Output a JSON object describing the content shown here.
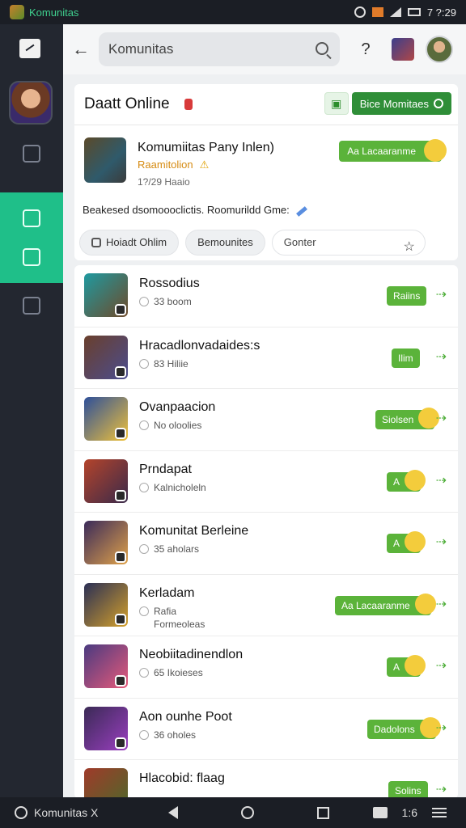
{
  "status_bar": {
    "app_name": "Komunitas",
    "time": "7 ?:29",
    "icons": [
      "alert-icon",
      "notification-icon",
      "signal-icon",
      "wifi-icon",
      "battery-icon"
    ]
  },
  "rail": {
    "items": [
      {
        "name": "compose",
        "icon": "compose-icon"
      },
      {
        "name": "home",
        "icon": "home-icon"
      },
      {
        "name": "book",
        "icon": "book-icon"
      },
      {
        "name": "discover",
        "icon": "compass-icon",
        "active": true
      },
      {
        "name": "groups",
        "icon": "group-icon"
      }
    ]
  },
  "topbar": {
    "back_icon": "back-arrow-icon",
    "search_value": "Komunitas",
    "help_icon": "help-icon"
  },
  "header": {
    "title": "Daatt Online",
    "action_label": "Bice Momitaes",
    "feature": {
      "title": "Komumiitas Pany Inlen)",
      "subtitle": "Raamitolion",
      "meta": "1?/29 Haaio",
      "follow_label": "Aa Lacaaranme"
    },
    "description": "Beakesed dsomoooclictis. Roomurildd Gme:",
    "chips": [
      "Hoiadt Ohlim",
      "Bemounites"
    ],
    "input_placeholder": "Gonter"
  },
  "list": [
    {
      "title": "Rossodius",
      "sub": "33 boom",
      "action": "Raiins",
      "has_smile": false,
      "colors": [
        "#1f9aa0",
        "#6e4a2a"
      ]
    },
    {
      "title": "Hracadlonvadaides:s",
      "sub": "83 Hiliie",
      "action": "Ilim",
      "has_smile": false,
      "colors": [
        "#6a3f2c",
        "#4b4d8e"
      ]
    },
    {
      "title": "Ovanpaacion",
      "sub": "No oloolies",
      "action": "Siolsen",
      "has_smile": true,
      "colors": [
        "#2d4f9a",
        "#f0c23a"
      ]
    },
    {
      "title": "Prndapat",
      "sub": "Kalnicholeln",
      "action": "A",
      "has_smile": true,
      "colors": [
        "#b4442b",
        "#3a2a4a"
      ]
    },
    {
      "title": "Komunitat Berleine",
      "sub": "35 aholars",
      "action": "A",
      "has_smile": true,
      "colors": [
        "#3a2a5a",
        "#e0a24a"
      ]
    },
    {
      "title": "Kerladam",
      "sub": "Rafia",
      "sub2": "Formeoleas",
      "action": "Aa Lacaaranme",
      "has_smile": true,
      "colors": [
        "#2a2f55",
        "#d4a02b"
      ]
    },
    {
      "title": "Neobiitadinendlon",
      "sub": "65 Ikoieses",
      "action": "A",
      "has_smile": true,
      "colors": [
        "#4a3a80",
        "#e65a7a"
      ]
    },
    {
      "title": "Aon ounhe Poot",
      "sub": "36 oholes",
      "action": "Dadolons",
      "has_smile": true,
      "colors": [
        "#3a2a55",
        "#9a3fc0"
      ]
    },
    {
      "title": "Hlacobid: flaag",
      "sub": "",
      "action": "Solins",
      "has_smile": false,
      "colors": [
        "#a03a2a",
        "#4a6a2a"
      ]
    }
  ],
  "navbar": {
    "left_label": "Komunitas X",
    "right_label": "1:6"
  }
}
